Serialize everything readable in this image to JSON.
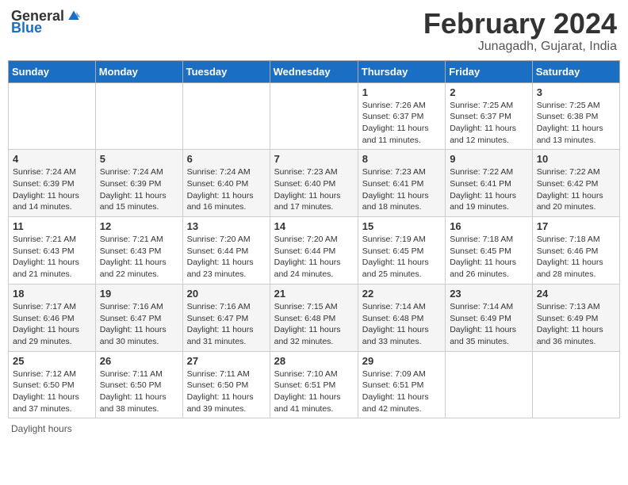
{
  "header": {
    "logo_general": "General",
    "logo_blue": "Blue",
    "month_title": "February 2024",
    "location": "Junagadh, Gujarat, India"
  },
  "footer": {
    "note": "Daylight hours"
  },
  "weekdays": [
    "Sunday",
    "Monday",
    "Tuesday",
    "Wednesday",
    "Thursday",
    "Friday",
    "Saturday"
  ],
  "weeks": [
    [
      {
        "day": "",
        "sunrise": "",
        "sunset": "",
        "daylight": ""
      },
      {
        "day": "",
        "sunrise": "",
        "sunset": "",
        "daylight": ""
      },
      {
        "day": "",
        "sunrise": "",
        "sunset": "",
        "daylight": ""
      },
      {
        "day": "",
        "sunrise": "",
        "sunset": "",
        "daylight": ""
      },
      {
        "day": "1",
        "sunrise": "Sunrise: 7:26 AM",
        "sunset": "Sunset: 6:37 PM",
        "daylight": "Daylight: 11 hours and 11 minutes."
      },
      {
        "day": "2",
        "sunrise": "Sunrise: 7:25 AM",
        "sunset": "Sunset: 6:37 PM",
        "daylight": "Daylight: 11 hours and 12 minutes."
      },
      {
        "day": "3",
        "sunrise": "Sunrise: 7:25 AM",
        "sunset": "Sunset: 6:38 PM",
        "daylight": "Daylight: 11 hours and 13 minutes."
      }
    ],
    [
      {
        "day": "4",
        "sunrise": "Sunrise: 7:24 AM",
        "sunset": "Sunset: 6:39 PM",
        "daylight": "Daylight: 11 hours and 14 minutes."
      },
      {
        "day": "5",
        "sunrise": "Sunrise: 7:24 AM",
        "sunset": "Sunset: 6:39 PM",
        "daylight": "Daylight: 11 hours and 15 minutes."
      },
      {
        "day": "6",
        "sunrise": "Sunrise: 7:24 AM",
        "sunset": "Sunset: 6:40 PM",
        "daylight": "Daylight: 11 hours and 16 minutes."
      },
      {
        "day": "7",
        "sunrise": "Sunrise: 7:23 AM",
        "sunset": "Sunset: 6:40 PM",
        "daylight": "Daylight: 11 hours and 17 minutes."
      },
      {
        "day": "8",
        "sunrise": "Sunrise: 7:23 AM",
        "sunset": "Sunset: 6:41 PM",
        "daylight": "Daylight: 11 hours and 18 minutes."
      },
      {
        "day": "9",
        "sunrise": "Sunrise: 7:22 AM",
        "sunset": "Sunset: 6:41 PM",
        "daylight": "Daylight: 11 hours and 19 minutes."
      },
      {
        "day": "10",
        "sunrise": "Sunrise: 7:22 AM",
        "sunset": "Sunset: 6:42 PM",
        "daylight": "Daylight: 11 hours and 20 minutes."
      }
    ],
    [
      {
        "day": "11",
        "sunrise": "Sunrise: 7:21 AM",
        "sunset": "Sunset: 6:43 PM",
        "daylight": "Daylight: 11 hours and 21 minutes."
      },
      {
        "day": "12",
        "sunrise": "Sunrise: 7:21 AM",
        "sunset": "Sunset: 6:43 PM",
        "daylight": "Daylight: 11 hours and 22 minutes."
      },
      {
        "day": "13",
        "sunrise": "Sunrise: 7:20 AM",
        "sunset": "Sunset: 6:44 PM",
        "daylight": "Daylight: 11 hours and 23 minutes."
      },
      {
        "day": "14",
        "sunrise": "Sunrise: 7:20 AM",
        "sunset": "Sunset: 6:44 PM",
        "daylight": "Daylight: 11 hours and 24 minutes."
      },
      {
        "day": "15",
        "sunrise": "Sunrise: 7:19 AM",
        "sunset": "Sunset: 6:45 PM",
        "daylight": "Daylight: 11 hours and 25 minutes."
      },
      {
        "day": "16",
        "sunrise": "Sunrise: 7:18 AM",
        "sunset": "Sunset: 6:45 PM",
        "daylight": "Daylight: 11 hours and 26 minutes."
      },
      {
        "day": "17",
        "sunrise": "Sunrise: 7:18 AM",
        "sunset": "Sunset: 6:46 PM",
        "daylight": "Daylight: 11 hours and 28 minutes."
      }
    ],
    [
      {
        "day": "18",
        "sunrise": "Sunrise: 7:17 AM",
        "sunset": "Sunset: 6:46 PM",
        "daylight": "Daylight: 11 hours and 29 minutes."
      },
      {
        "day": "19",
        "sunrise": "Sunrise: 7:16 AM",
        "sunset": "Sunset: 6:47 PM",
        "daylight": "Daylight: 11 hours and 30 minutes."
      },
      {
        "day": "20",
        "sunrise": "Sunrise: 7:16 AM",
        "sunset": "Sunset: 6:47 PM",
        "daylight": "Daylight: 11 hours and 31 minutes."
      },
      {
        "day": "21",
        "sunrise": "Sunrise: 7:15 AM",
        "sunset": "Sunset: 6:48 PM",
        "daylight": "Daylight: 11 hours and 32 minutes."
      },
      {
        "day": "22",
        "sunrise": "Sunrise: 7:14 AM",
        "sunset": "Sunset: 6:48 PM",
        "daylight": "Daylight: 11 hours and 33 minutes."
      },
      {
        "day": "23",
        "sunrise": "Sunrise: 7:14 AM",
        "sunset": "Sunset: 6:49 PM",
        "daylight": "Daylight: 11 hours and 35 minutes."
      },
      {
        "day": "24",
        "sunrise": "Sunrise: 7:13 AM",
        "sunset": "Sunset: 6:49 PM",
        "daylight": "Daylight: 11 hours and 36 minutes."
      }
    ],
    [
      {
        "day": "25",
        "sunrise": "Sunrise: 7:12 AM",
        "sunset": "Sunset: 6:50 PM",
        "daylight": "Daylight: 11 hours and 37 minutes."
      },
      {
        "day": "26",
        "sunrise": "Sunrise: 7:11 AM",
        "sunset": "Sunset: 6:50 PM",
        "daylight": "Daylight: 11 hours and 38 minutes."
      },
      {
        "day": "27",
        "sunrise": "Sunrise: 7:11 AM",
        "sunset": "Sunset: 6:50 PM",
        "daylight": "Daylight: 11 hours and 39 minutes."
      },
      {
        "day": "28",
        "sunrise": "Sunrise: 7:10 AM",
        "sunset": "Sunset: 6:51 PM",
        "daylight": "Daylight: 11 hours and 41 minutes."
      },
      {
        "day": "29",
        "sunrise": "Sunrise: 7:09 AM",
        "sunset": "Sunset: 6:51 PM",
        "daylight": "Daylight: 11 hours and 42 minutes."
      },
      {
        "day": "",
        "sunrise": "",
        "sunset": "",
        "daylight": ""
      },
      {
        "day": "",
        "sunrise": "",
        "sunset": "",
        "daylight": ""
      }
    ]
  ]
}
